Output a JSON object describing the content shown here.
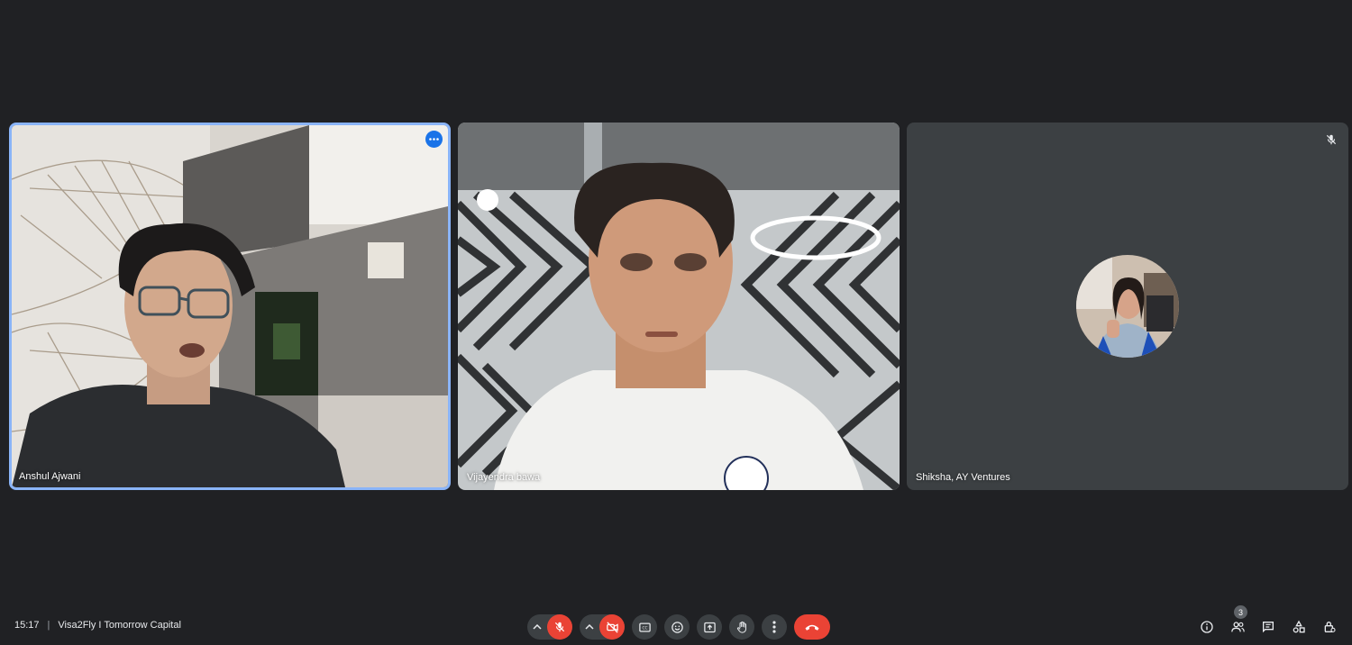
{
  "participants": [
    {
      "name": "Anshul Ajwani"
    },
    {
      "name": "Vijayendra bawa"
    },
    {
      "name": "Shiksha, AY Ventures"
    }
  ],
  "meeting": {
    "time": "15:17",
    "separator": "|",
    "title": "Visa2Fly I Tomorrow Capital"
  },
  "people_count": "3",
  "icons": {
    "more": "more-options-icon",
    "mic_off": "mic-off-icon",
    "cam_off": "camera-off-icon",
    "captions": "captions-icon",
    "emoji": "emoji-icon",
    "present": "present-screen-icon",
    "hand": "raise-hand-icon",
    "more_vert": "more-vert-icon",
    "end_call": "end-call-icon",
    "info": "info-icon",
    "people": "people-icon",
    "chat": "chat-icon",
    "activities": "activities-icon",
    "host": "host-controls-icon"
  },
  "colors": {
    "active_speaker": "#8ab4f8",
    "danger": "#ea4335",
    "accent": "#1a73e8"
  }
}
